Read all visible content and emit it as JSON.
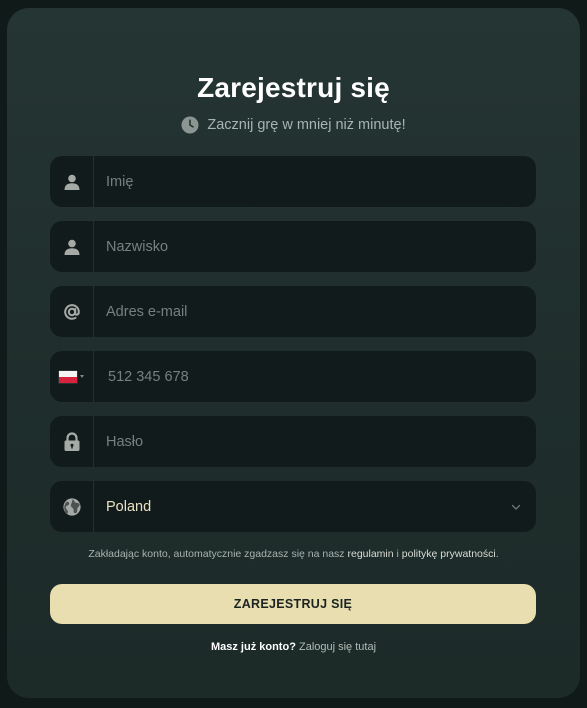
{
  "header": {
    "title": "Zarejestruj się",
    "subtitle": "Zacznij grę w mniej niż minutę!"
  },
  "fields": {
    "first_name": {
      "placeholder": "Imię",
      "icon": "user-icon"
    },
    "last_name": {
      "placeholder": "Nazwisko",
      "icon": "user-icon"
    },
    "email": {
      "placeholder": "Adres e-mail",
      "icon": "at-icon"
    },
    "phone": {
      "placeholder": "512 345 678",
      "icon": "flag-pl-icon"
    },
    "password": {
      "placeholder": "Hasło",
      "icon": "lock-icon"
    },
    "country": {
      "value": "Poland",
      "icon": "globe-icon"
    }
  },
  "terms": {
    "prefix": "Zakładając konto, automatycznie zgadzasz się na nasz ",
    "regulamin": "regulamin",
    "middle": " i ",
    "privacy": "politykę prywatności",
    "suffix": "."
  },
  "submit": {
    "label": "ZAREJESTRUJ SIĘ"
  },
  "login": {
    "question": "Masz już konto?",
    "link": "Zaloguj się tutaj"
  },
  "colors": {
    "modal_bg": "#223230",
    "field_bg": "#121b1b",
    "cta_bg": "#e8deb0",
    "placeholder": "#76807e",
    "select_text": "#e9e2c2"
  }
}
